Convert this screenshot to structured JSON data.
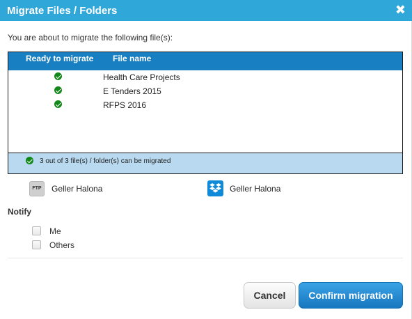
{
  "dialog": {
    "title": "Migrate Files / Folders",
    "close_glyph": "✖",
    "intro": "You are about to migrate the following file(s):"
  },
  "table": {
    "headers": [
      "Ready to migrate",
      "File name"
    ],
    "rows": [
      {
        "status": "check-icon",
        "name": "Health Care Projects"
      },
      {
        "status": "check-icon",
        "name": "E Tenders 2015"
      },
      {
        "status": "check-icon",
        "name": "RFPS 2016"
      }
    ],
    "summary": "3 out of 3 file(s) / folder(s) can be migrated"
  },
  "source": {
    "icon": "ftp-icon",
    "icon_text": "FTP",
    "name": "Geller Halona"
  },
  "target": {
    "icon": "dropbox-icon",
    "name": "Geller Halona"
  },
  "notify": {
    "label": "Notify",
    "options": [
      {
        "label": "Me",
        "checked": false
      },
      {
        "label": "Others",
        "checked": false
      }
    ]
  },
  "buttons": {
    "cancel": "Cancel",
    "confirm": "Confirm migration"
  },
  "colors": {
    "titlebar": "#2fa7d8",
    "table_header": "#177fc2",
    "summary_bg": "#b8d9ef",
    "check": "#13881a",
    "dropbox": "#0e8ad8",
    "confirm": "#1776be"
  }
}
